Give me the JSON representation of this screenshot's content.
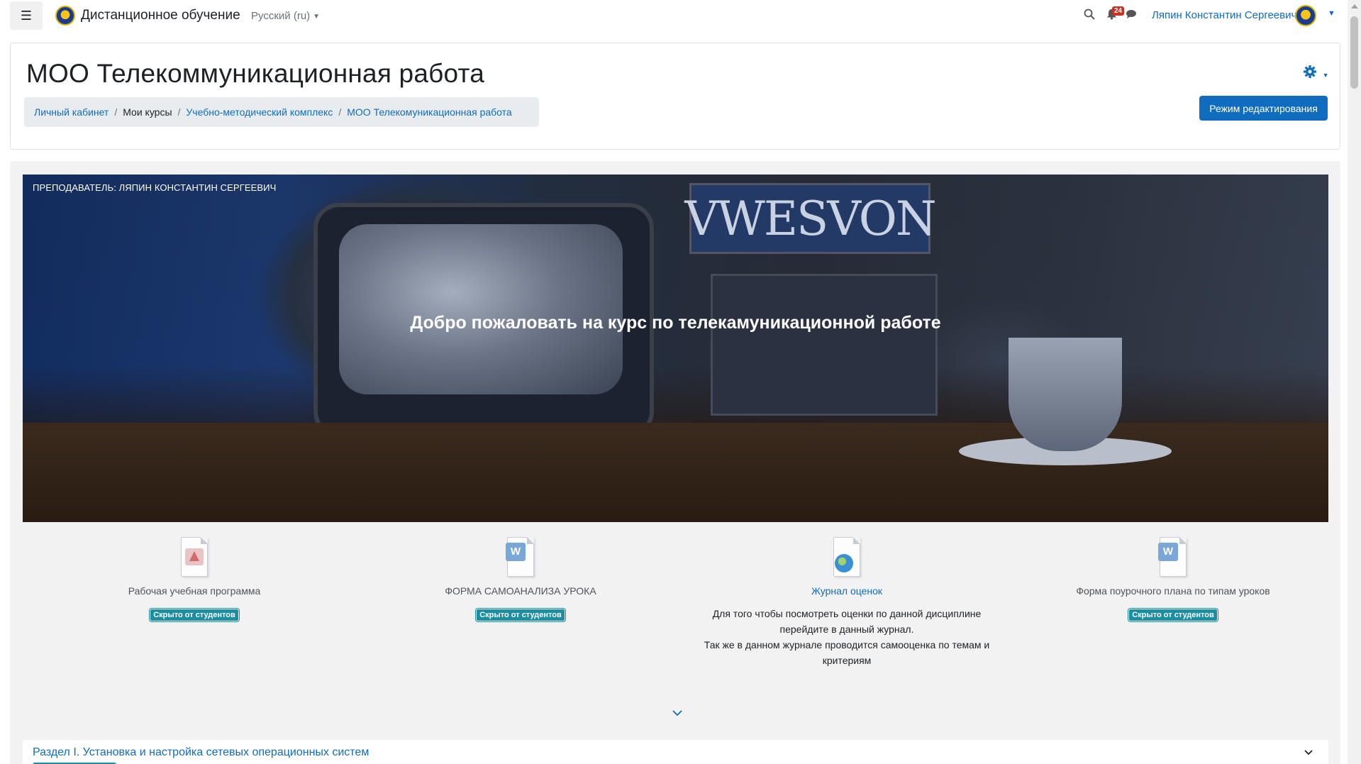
{
  "navbar": {
    "brand": "Дистанционное обучение",
    "language": "Русский (ru)",
    "notification_count": "24",
    "user_name": "Ляпин Константин Сергеевич",
    "icons": [
      "menu-icon",
      "search-icon",
      "bell-icon",
      "chat-icon",
      "chevron-down-icon"
    ]
  },
  "header": {
    "title": "МОО Телекоммуникационная работа",
    "breadcrumb": [
      "Личный кабинет",
      "Мои курсы",
      "Учебно-методический комплекс",
      "МОО Телекомуникационная работа"
    ],
    "edit_button": "Режим редактирования"
  },
  "hero": {
    "teacher": "ПРЕПОДАВАТЕЛЬ: ЛЯПИН КОНСТАНТИН СЕРГЕЕВИЧ",
    "welcome": "Добро пожаловать на курс по телекамуникационной работе",
    "sign_text": "VWESVON"
  },
  "activities": [
    {
      "title": "Рабочая учебная программа",
      "icon": "pdf-file-icon",
      "badge": "Скрыто от студентов"
    },
    {
      "title": "ФОРМА САМОАНАЛИЗА УРОКА",
      "icon": "word-file-icon",
      "badge": "Скрыто от студентов"
    },
    {
      "title": "Журнал оценок",
      "icon": "web-page-icon",
      "description": [
        "Для того чтобы посмотреть оценки по данной дисциплине",
        "перейдите в данный журнал.",
        "Так же в данном журнале проводится самооценка по темам и",
        "критериям"
      ]
    },
    {
      "title": "Форма поурочного плана по типам уроков",
      "icon": "word-file-icon",
      "badge": "Скрыто от студентов"
    }
  ],
  "section": {
    "title": "Раздел I. Установка и настройка сетевых операционных систем"
  },
  "colors": {
    "primary": "#0f6cbf",
    "badge_info": "#1a8ea3",
    "notification": "#ca3120",
    "course_bg": "#f2f2f2",
    "breadcrumb_bg": "#e9ecef"
  }
}
